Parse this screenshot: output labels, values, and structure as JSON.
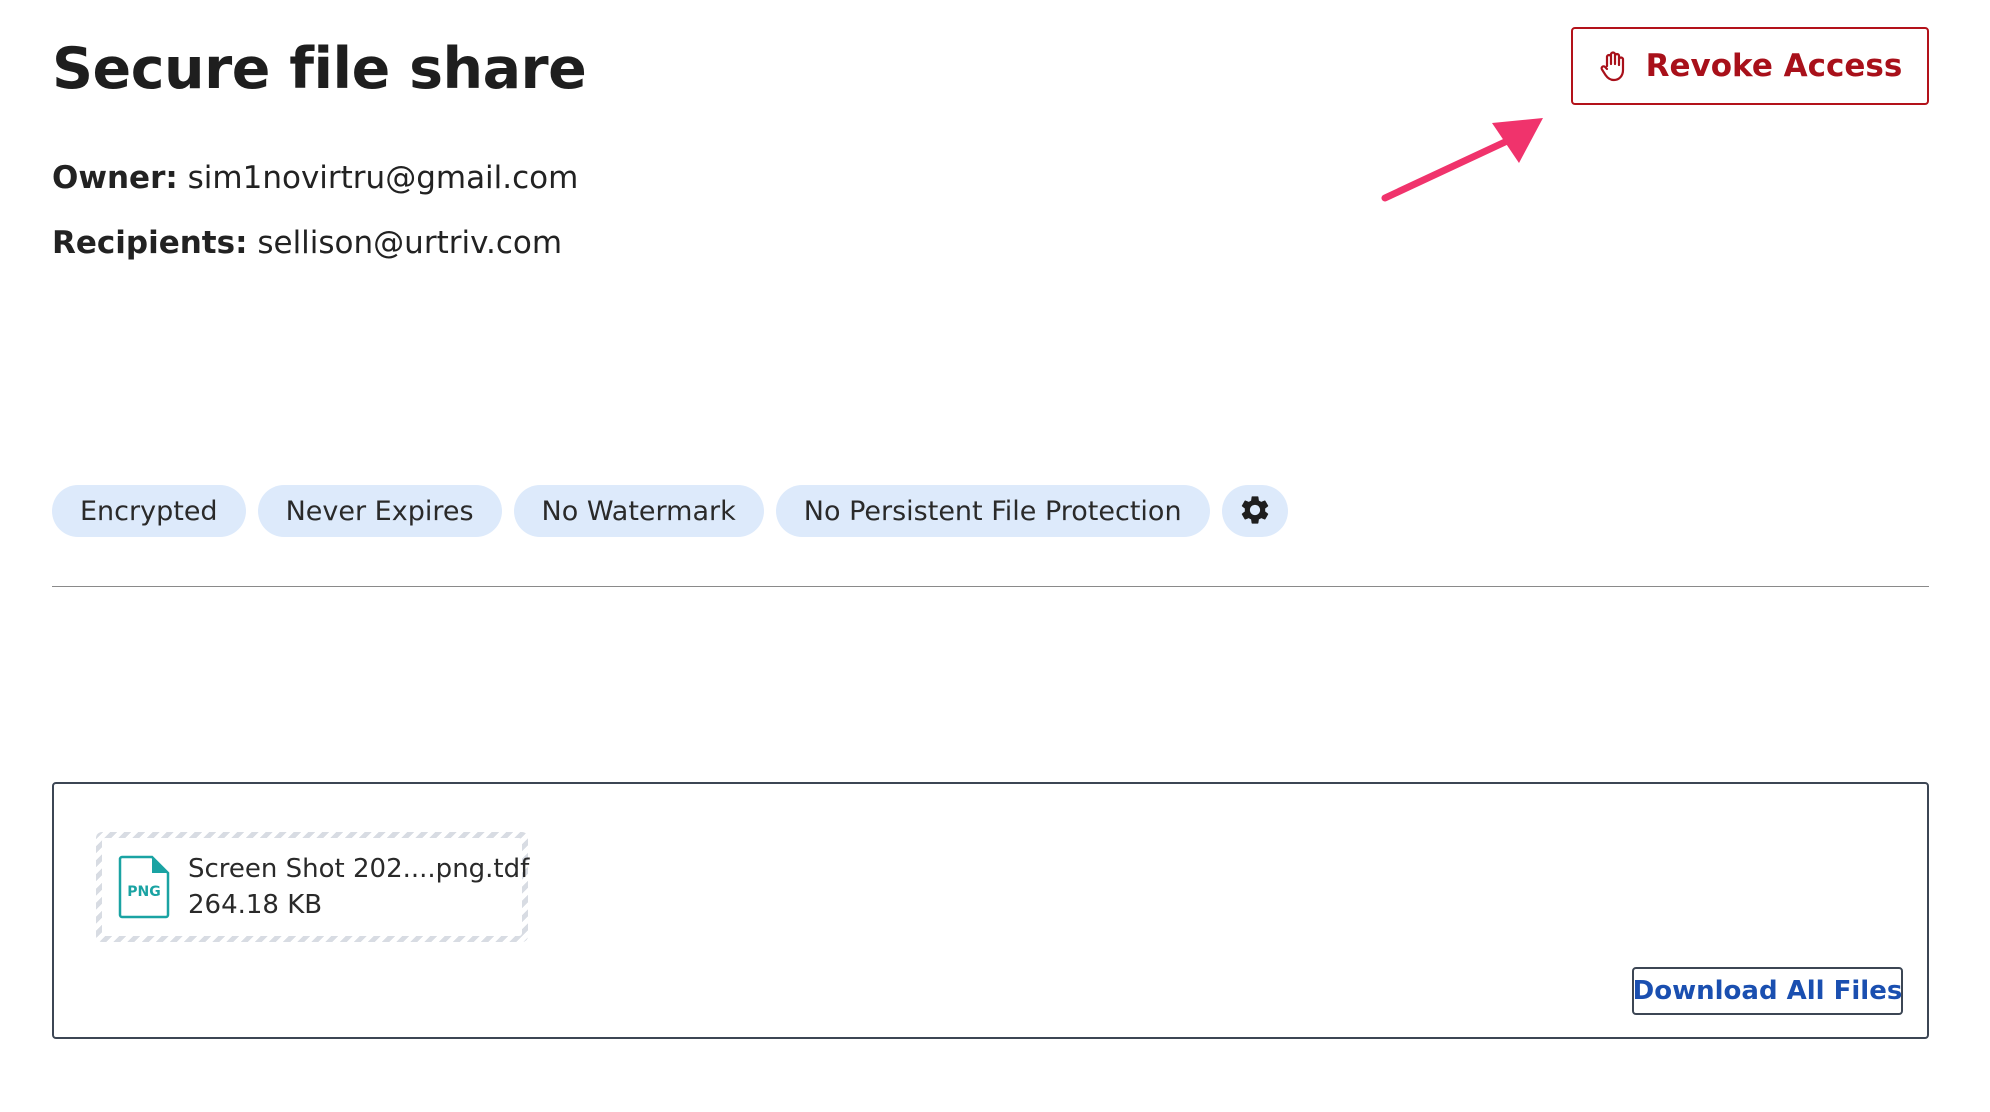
{
  "header": {
    "title": "Secure file share",
    "revoke_label": "Revoke Access",
    "revoke_icon": "hand-stop-icon",
    "revoke_color": "#b3121a"
  },
  "meta": {
    "owner_label": "Owner:",
    "owner_value": "sim1novirtru@gmail.com",
    "recipients_label": "Recipients:",
    "recipients_value": "sellison@urtriv.com"
  },
  "tags": [
    {
      "label": "Encrypted"
    },
    {
      "label": "Never Expires"
    },
    {
      "label": "No Watermark"
    },
    {
      "label": "No Persistent File Protection"
    }
  ],
  "settings": {
    "icon": "gear-icon"
  },
  "files": {
    "items": [
      {
        "name": "Screen Shot 202....png.tdf",
        "size": "264.18 KB",
        "type_badge": "PNG"
      }
    ],
    "download_all_label": "Download All Files"
  },
  "colors": {
    "accent_red": "#b3121a",
    "annotation_pink": "#f0336c",
    "link_blue": "#1a4fb0",
    "tag_background": "#ddeafb",
    "file_icon_teal": "#1aa3a3"
  }
}
